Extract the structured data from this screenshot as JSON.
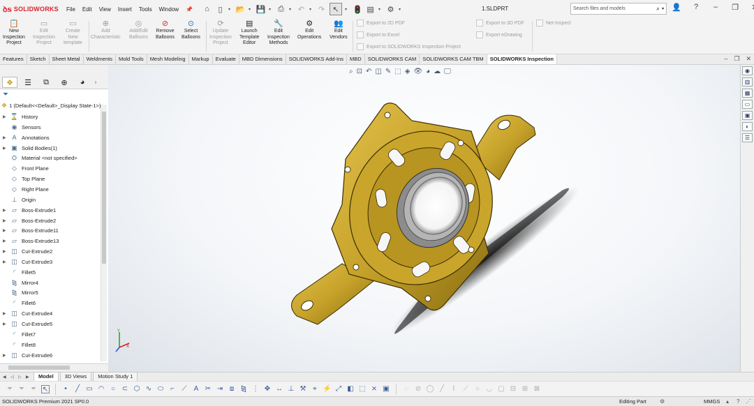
{
  "app": {
    "brand": "SOLIDWORKS",
    "document_title": "1.SLDPRT"
  },
  "menu": [
    "File",
    "Edit",
    "View",
    "Insert",
    "Tools",
    "Window"
  ],
  "quick_access": [
    "home-icon",
    "new-icon",
    "open-icon",
    "save-icon",
    "print-icon",
    "undo-icon",
    "redo-icon",
    "select-icon",
    "rebuild-icon",
    "file-properties-icon",
    "options-icon"
  ],
  "search": {
    "placeholder": "Search files and models"
  },
  "ribbon": {
    "buttons": [
      {
        "label": "New\nInspection\nProject",
        "enabled": true
      },
      {
        "label": "Edit\nInspection\nProject",
        "enabled": false
      },
      {
        "label": "Create\nNew\ntemplate",
        "enabled": false
      },
      {
        "label": "Add\nCharacteristic",
        "enabled": false
      },
      {
        "label": "Add/Edit\nBalloons",
        "enabled": false
      },
      {
        "label": "Remove\nBalloons",
        "enabled": true
      },
      {
        "label": "Select\nBalloons",
        "enabled": true
      },
      {
        "label": "Update\nInspection\nProject",
        "enabled": false
      },
      {
        "label": "Launch\nTemplate\nEditor",
        "enabled": true
      },
      {
        "label": "Edit\nInspection\nMethods",
        "enabled": true
      },
      {
        "label": "Edit\nOperations",
        "enabled": true
      },
      {
        "label": "Edit\nVendors",
        "enabled": true
      }
    ],
    "export_2d_pdf": "Export to 2D PDF",
    "export_excel": "Export to Excel",
    "export_sw_inspection": "Export to SOLIDWORKS Inspection Project",
    "export_3d_pdf": "Export to 3D PDF",
    "export_edrawing": "Export eDrawing",
    "net_inspect": "Net-Inspect"
  },
  "command_tabs": [
    "Features",
    "Sketch",
    "Sheet Metal",
    "Weldments",
    "Mold Tools",
    "Mesh Modeling",
    "Markup",
    "Evaluate",
    "MBD Dimensions",
    "SOLIDWORKS Add-Ins",
    "MBD",
    "SOLIDWORKS CAM",
    "SOLIDWORKS CAM TBM",
    "SOLIDWORKS Inspection"
  ],
  "active_command_tab": "SOLIDWORKS Inspection",
  "feature_tree": {
    "root": "1  (Default<<Default>_Display State-1>)",
    "items": [
      {
        "label": "History",
        "icon": "history-icon",
        "expandable": true
      },
      {
        "label": "Sensors",
        "icon": "sensors-icon",
        "expandable": false
      },
      {
        "label": "Annotations",
        "icon": "annotations-icon",
        "expandable": true
      },
      {
        "label": "Solid Bodies(1)",
        "icon": "solid-bodies-icon",
        "expandable": true
      },
      {
        "label": "Material <not specified>",
        "icon": "material-icon",
        "expandable": false
      },
      {
        "label": "Front Plane",
        "icon": "plane-icon",
        "expandable": false
      },
      {
        "label": "Top Plane",
        "icon": "plane-icon",
        "expandable": false
      },
      {
        "label": "Right Plane",
        "icon": "plane-icon",
        "expandable": false
      },
      {
        "label": "Origin",
        "icon": "origin-icon",
        "expandable": false
      },
      {
        "label": "Boss-Extrude1",
        "icon": "boss-extrude-icon",
        "expandable": true
      },
      {
        "label": "Boss-Extrude2",
        "icon": "boss-extrude-icon",
        "expandable": true
      },
      {
        "label": "Boss-Extrude11",
        "icon": "boss-extrude-icon",
        "expandable": true
      },
      {
        "label": "Boss-Extrude13",
        "icon": "boss-extrude-icon",
        "expandable": true
      },
      {
        "label": "Cut-Extrude2",
        "icon": "cut-extrude-icon",
        "expandable": true
      },
      {
        "label": "Cut-Extrude3",
        "icon": "cut-extrude-icon",
        "expandable": true
      },
      {
        "label": "Fillet5",
        "icon": "fillet-icon",
        "expandable": false
      },
      {
        "label": "Mirror4",
        "icon": "mirror-icon",
        "expandable": false
      },
      {
        "label": "Mirror5",
        "icon": "mirror-icon",
        "expandable": false
      },
      {
        "label": "Fillet6",
        "icon": "fillet-icon",
        "expandable": false
      },
      {
        "label": "Cut-Extrude4",
        "icon": "cut-extrude-icon",
        "expandable": true
      },
      {
        "label": "Cut-Extrude5",
        "icon": "cut-extrude-icon",
        "expandable": true
      },
      {
        "label": "Fillet7",
        "icon": "fillet-icon",
        "expandable": false
      },
      {
        "label": "Fillet8",
        "icon": "fillet-icon",
        "expandable": false
      },
      {
        "label": "Cut-Extrude6",
        "icon": "cut-extrude-icon",
        "expandable": true
      }
    ]
  },
  "bottom_tabs": [
    "Model",
    "3D Views",
    "Motion Study 1"
  ],
  "active_bottom_tab": "Model",
  "status": {
    "left": "SOLIDWORKS Premium 2021 SP0.0",
    "mode": "Editing Part",
    "units": "MMGS"
  },
  "colors": {
    "part": "#c6a22a",
    "brand": "#d8232a",
    "accent": "#2a6fb3"
  }
}
